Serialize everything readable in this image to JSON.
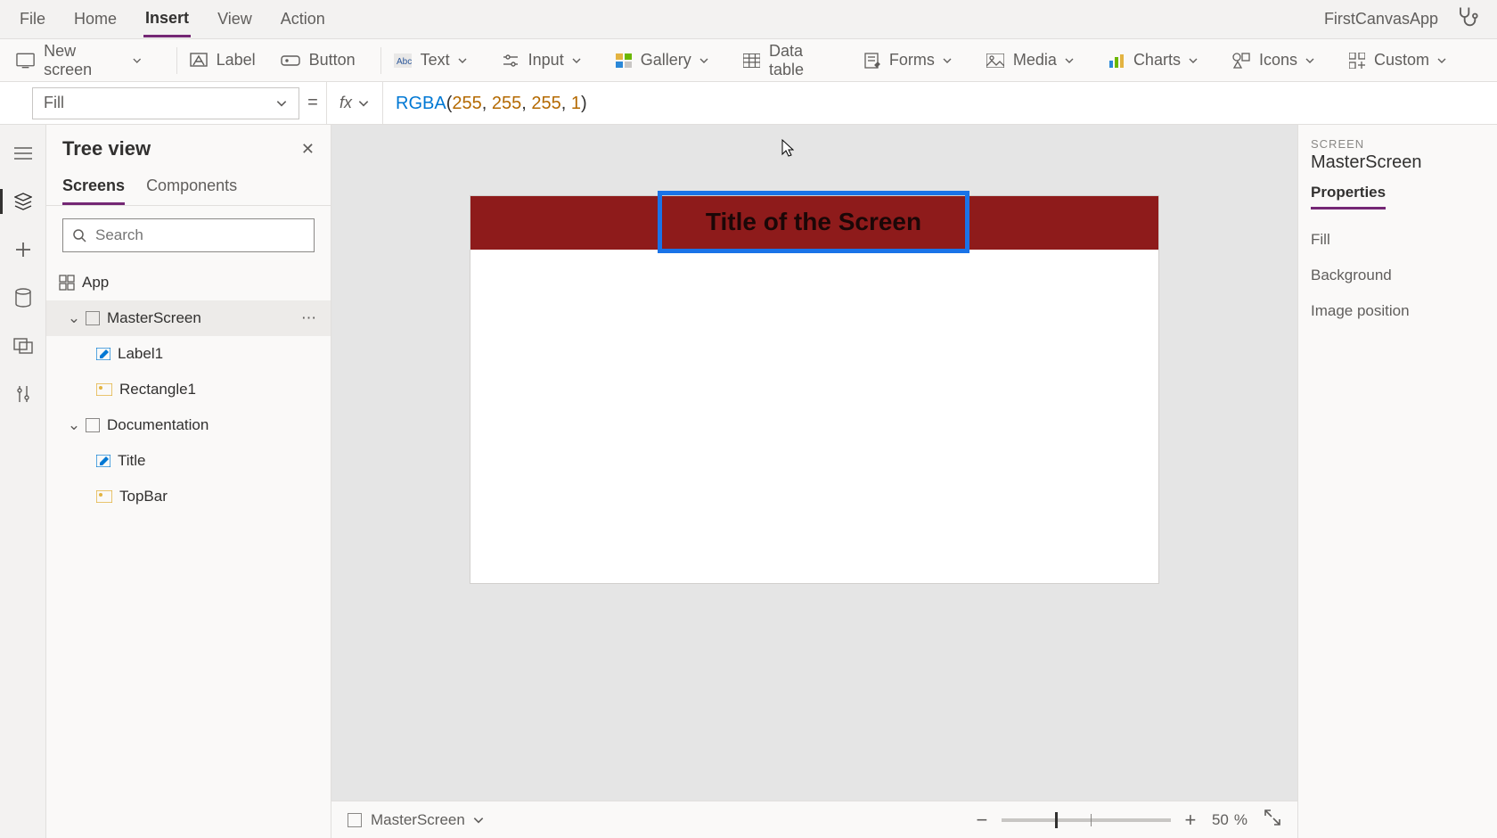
{
  "menu": {
    "items": [
      "File",
      "Home",
      "Insert",
      "View",
      "Action"
    ],
    "active": 2,
    "appName": "FirstCanvasApp"
  },
  "ribbon": {
    "newScreen": "New screen",
    "label": "Label",
    "button": "Button",
    "text": "Text",
    "input": "Input",
    "gallery": "Gallery",
    "dataTable": "Data table",
    "forms": "Forms",
    "media": "Media",
    "charts": "Charts",
    "icons": "Icons",
    "custom": "Custom"
  },
  "formula": {
    "property": "Fill",
    "fn": "RGBA",
    "args": [
      "255",
      "255",
      "255",
      "1"
    ]
  },
  "tree": {
    "title": "Tree view",
    "tabs": {
      "screens": "Screens",
      "components": "Components"
    },
    "searchPlaceholder": "Search",
    "app": "App",
    "nodes": {
      "master": "MasterScreen",
      "label1": "Label1",
      "rect1": "Rectangle1",
      "doc": "Documentation",
      "title": "Title",
      "topbar": "TopBar"
    }
  },
  "canvas": {
    "titleText": "Title of the Screen"
  },
  "status": {
    "screen": "MasterScreen",
    "zoom": "50",
    "pct": "%"
  },
  "props": {
    "kindLabel": "SCREEN",
    "name": "MasterScreen",
    "tab": "Properties",
    "rows": [
      "Fill",
      "Background",
      "Image position"
    ]
  }
}
